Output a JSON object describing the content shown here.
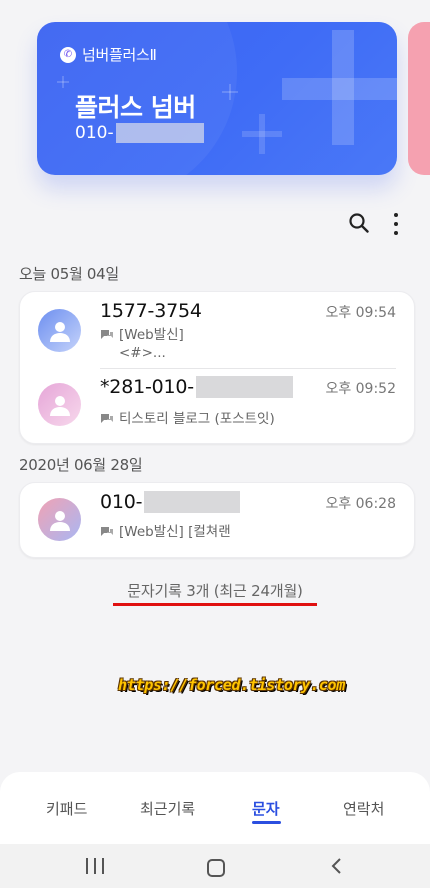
{
  "card": {
    "brand": "넘버플러스Ⅱ",
    "title": "플러스 넘버",
    "number_prefix": "010-",
    "color": "#3f6cf6",
    "side_card_color": "#f5a1b0"
  },
  "toolbar": {
    "search_icon": "search-icon",
    "more_icon": "more-vertical-icon"
  },
  "groups": [
    {
      "date": "오늘 05월 04일",
      "messages": [
        {
          "name": "1577-3754",
          "time": "오후 09:54",
          "preview_lines": [
            "[Web발신]",
            "<#>..."
          ],
          "avatar_color": "blue"
        },
        {
          "name": "*281-010-",
          "time": "오후 09:52",
          "preview_lines": [
            "티스토리 블로그 (포스트잇)"
          ],
          "avatar_color": "pink"
        }
      ]
    },
    {
      "date": "2020년 06월 28일",
      "messages": [
        {
          "name": "010-",
          "time": "오후 06:28",
          "preview_lines": [
            "[Web발신] [컬쳐랜"
          ],
          "avatar_color": "mixed"
        }
      ]
    }
  ],
  "summary": "문자기록 3개 (최근 24개월)",
  "watermark": "https://forced.tistory.com",
  "bottom_nav": {
    "tabs": [
      "키패드",
      "최근기록",
      "문자",
      "연락처"
    ],
    "active": "문자",
    "active_color": "#2b4fe0"
  },
  "system_nav": [
    "recents-icon",
    "home-icon",
    "back-icon"
  ]
}
